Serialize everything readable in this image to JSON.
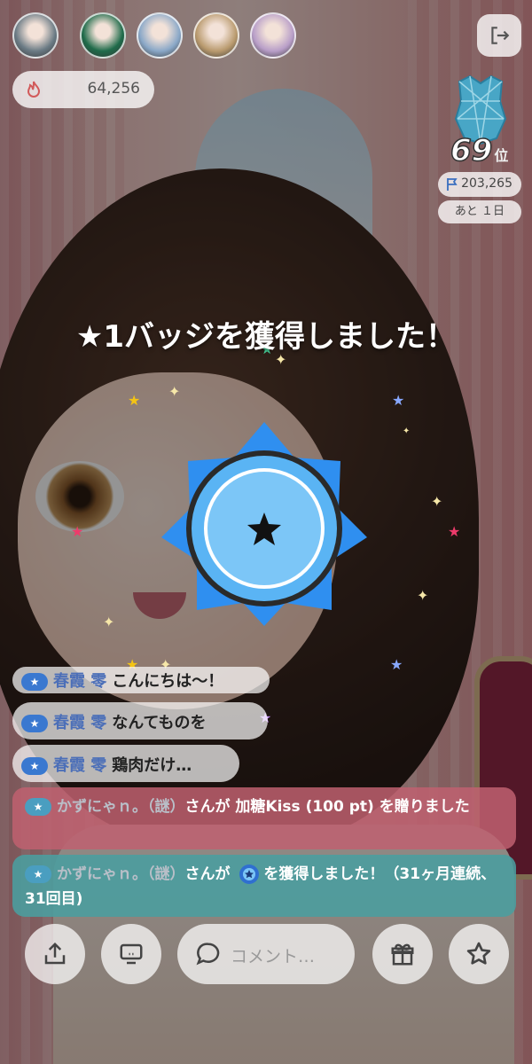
{
  "colors": {
    "badge_blue": "#2f8ff0",
    "badge_blue_light": "#7cc6f7",
    "gift_bar": "#c06070",
    "badge_bar": "#4a9e9f"
  },
  "top_avatars": [
    {
      "name": "avatar-1",
      "tint": "#6a7a84"
    },
    {
      "name": "avatar-2",
      "tint": "#1f6b4a"
    },
    {
      "name": "avatar-3",
      "tint": "#8aa8c8"
    },
    {
      "name": "avatar-4",
      "tint": "#b99a6e"
    },
    {
      "name": "avatar-5",
      "tint": "#b89ec8"
    }
  ],
  "exit_icon": "exit-icon",
  "points": {
    "icon": "flame-icon",
    "value": "64,256"
  },
  "ranking": {
    "rank_number": "69",
    "rank_suffix": "位",
    "score_icon": "flag-icon",
    "score": "203,265",
    "remaining": "あと １日"
  },
  "overlay": {
    "message": "★1バッジを獲得しました！",
    "badge_icon": "star-badge-icon"
  },
  "chat": [
    {
      "badge": "★",
      "name": "春霞 零",
      "text": "こんにちは〜！"
    },
    {
      "badge": "★",
      "name": "春霞 零",
      "text": "なんてものを"
    },
    {
      "badge": "★",
      "name": "春霞 零",
      "text": "鶏肉だけ…"
    }
  ],
  "gift_message": {
    "badge": "★",
    "user": "かずにゃｎ。（謎）",
    "text": "さんが 加糖Kiss (100 pt) を贈りました"
  },
  "badge_message": {
    "badge": "★",
    "user": "かずにゃｎ。（謎）",
    "text_before": "さんが",
    "text_after": "を獲得しました！（31ヶ月連続、31回目)"
  },
  "bottom_bar": {
    "share_icon": "share-icon",
    "screen_icon": "screen-icon",
    "comment_icon": "comment-icon",
    "comment_placeholder": "コメント…",
    "gift_icon": "gift-icon",
    "favorite_icon": "star-outline-icon"
  }
}
